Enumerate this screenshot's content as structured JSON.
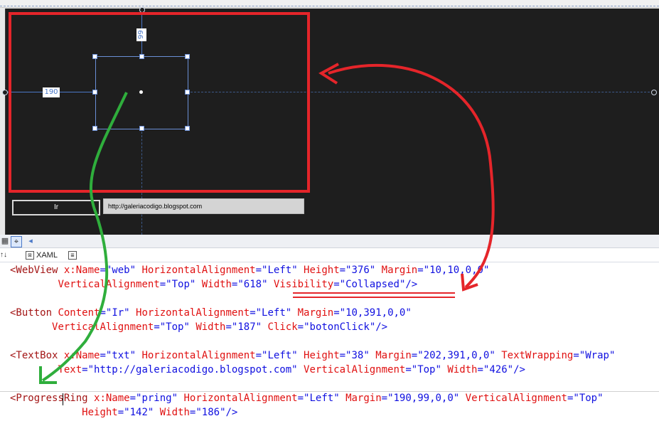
{
  "designer": {
    "margin_top_value": "99",
    "margin_left_value": "190",
    "button_label": "Ir",
    "textbox_text": "http://galeriacodigo.blogspot.com"
  },
  "tabs": {
    "xaml_label": "XAML"
  },
  "code_lines": [
    {
      "indent": "",
      "parts": [
        [
          "tag",
          "<WebView "
        ],
        [
          "attr",
          "x:Name"
        ],
        [
          "plain",
          "=\""
        ],
        [
          "val",
          "web"
        ],
        [
          "plain",
          "\" "
        ],
        [
          "attr",
          "HorizontalAlignment"
        ],
        [
          "plain",
          "=\""
        ],
        [
          "val",
          "Left"
        ],
        [
          "plain",
          "\" "
        ],
        [
          "attr",
          "Height"
        ],
        [
          "plain",
          "=\""
        ],
        [
          "val",
          "376"
        ],
        [
          "plain",
          "\" "
        ],
        [
          "attr",
          "Margin"
        ],
        [
          "plain",
          "=\""
        ],
        [
          "val",
          "10,10,0,0"
        ],
        [
          "plain",
          "\""
        ]
      ]
    },
    {
      "indent": "        ",
      "parts": [
        [
          "attr",
          "VerticalAlignment"
        ],
        [
          "plain",
          "=\""
        ],
        [
          "val",
          "Top"
        ],
        [
          "plain",
          "\" "
        ],
        [
          "attr",
          "Width"
        ],
        [
          "plain",
          "=\""
        ],
        [
          "val",
          "618"
        ],
        [
          "plain",
          "\" "
        ],
        [
          "attr",
          "Visibility"
        ],
        [
          "plain",
          "=\""
        ],
        [
          "val",
          "Collapsed"
        ],
        [
          "plain",
          "\"/>"
        ]
      ]
    },
    {
      "indent": "",
      "parts": []
    },
    {
      "indent": "",
      "parts": [
        [
          "tag",
          "<Button "
        ],
        [
          "attr",
          "Content"
        ],
        [
          "plain",
          "=\""
        ],
        [
          "val",
          "Ir"
        ],
        [
          "plain",
          "\" "
        ],
        [
          "attr",
          "HorizontalAlignment"
        ],
        [
          "plain",
          "=\""
        ],
        [
          "val",
          "Left"
        ],
        [
          "plain",
          "\" "
        ],
        [
          "attr",
          "Margin"
        ],
        [
          "plain",
          "=\""
        ],
        [
          "val",
          "10,391,0,0"
        ],
        [
          "plain",
          "\""
        ]
      ]
    },
    {
      "indent": "       ",
      "parts": [
        [
          "attr",
          "VerticalAlignment"
        ],
        [
          "plain",
          "=\""
        ],
        [
          "val",
          "Top"
        ],
        [
          "plain",
          "\" "
        ],
        [
          "attr",
          "Width"
        ],
        [
          "plain",
          "=\""
        ],
        [
          "val",
          "187"
        ],
        [
          "plain",
          "\" "
        ],
        [
          "attr",
          "Click"
        ],
        [
          "plain",
          "=\""
        ],
        [
          "val",
          "botonClick"
        ],
        [
          "plain",
          "\"/>"
        ]
      ]
    },
    {
      "indent": "",
      "parts": []
    },
    {
      "indent": "",
      "parts": [
        [
          "tag",
          "<TextBox "
        ],
        [
          "attr",
          "x:Name"
        ],
        [
          "plain",
          "=\""
        ],
        [
          "val",
          "txt"
        ],
        [
          "plain",
          "\" "
        ],
        [
          "attr",
          "HorizontalAlignment"
        ],
        [
          "plain",
          "=\""
        ],
        [
          "val",
          "Left"
        ],
        [
          "plain",
          "\" "
        ],
        [
          "attr",
          "Height"
        ],
        [
          "plain",
          "=\""
        ],
        [
          "val",
          "38"
        ],
        [
          "plain",
          "\" "
        ],
        [
          "attr",
          "Margin"
        ],
        [
          "plain",
          "=\""
        ],
        [
          "val",
          "202,391,0,0"
        ],
        [
          "plain",
          "\" "
        ],
        [
          "attr",
          "TextWrapping"
        ],
        [
          "plain",
          "=\""
        ],
        [
          "val",
          "Wrap"
        ],
        [
          "plain",
          "\""
        ]
      ]
    },
    {
      "indent": "        ",
      "parts": [
        [
          "attr",
          "Text"
        ],
        [
          "plain",
          "=\""
        ],
        [
          "val",
          "http://galeriacodigo.blogspot.com"
        ],
        [
          "plain",
          "\" "
        ],
        [
          "attr",
          "VerticalAlignment"
        ],
        [
          "plain",
          "=\""
        ],
        [
          "val",
          "Top"
        ],
        [
          "plain",
          "\" "
        ],
        [
          "attr",
          "Width"
        ],
        [
          "plain",
          "=\""
        ],
        [
          "val",
          "426"
        ],
        [
          "plain",
          "\"/>"
        ]
      ]
    },
    {
      "indent": "",
      "parts": []
    },
    {
      "indent": "",
      "parts": [
        [
          "tag",
          "<ProgressRing "
        ],
        [
          "attr",
          "x:Name"
        ],
        [
          "plain",
          "=\""
        ],
        [
          "val",
          "pring"
        ],
        [
          "plain",
          "\" "
        ],
        [
          "attr",
          "HorizontalAlignment"
        ],
        [
          "plain",
          "=\""
        ],
        [
          "val",
          "Left"
        ],
        [
          "plain",
          "\" "
        ],
        [
          "attr",
          "Margin"
        ],
        [
          "plain",
          "=\""
        ],
        [
          "val",
          "190,99,0,0"
        ],
        [
          "plain",
          "\" "
        ],
        [
          "attr",
          "VerticalAlignment"
        ],
        [
          "plain",
          "=\""
        ],
        [
          "val",
          "Top"
        ],
        [
          "plain",
          "\""
        ]
      ]
    },
    {
      "indent": "            ",
      "parts": [
        [
          "attr",
          "Height"
        ],
        [
          "plain",
          "=\""
        ],
        [
          "val",
          "142"
        ],
        [
          "plain",
          "\" "
        ],
        [
          "attr",
          "Width"
        ],
        [
          "plain",
          "=\""
        ],
        [
          "val",
          "186"
        ],
        [
          "plain",
          "\"/>"
        ]
      ]
    }
  ],
  "colors": {
    "annotation_red": "#e5252a",
    "annotation_green": "#2fae3c",
    "designer_background": "#1e1e1e"
  }
}
